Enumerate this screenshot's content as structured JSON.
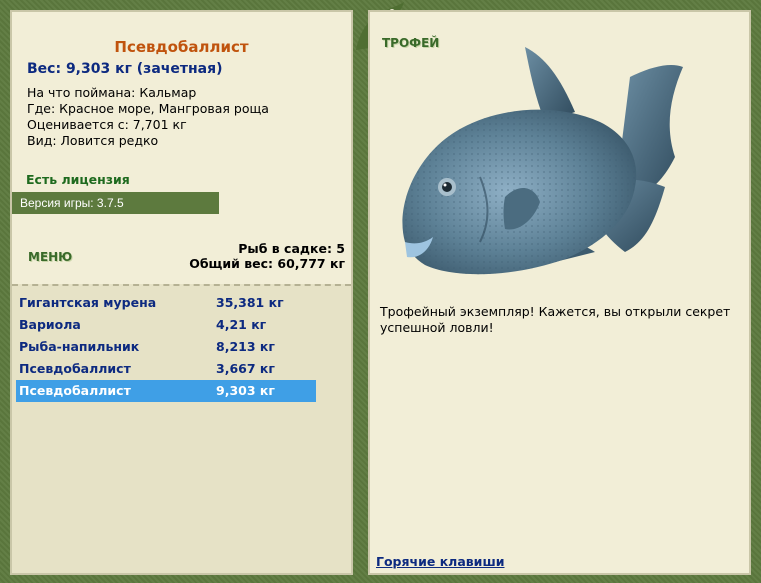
{
  "fish": {
    "name": "Псевдобаллист",
    "weight_line": "Вес: 9,303 кг (зачетная)",
    "bait": "На что поймана: Кальмар",
    "location": "Где: Красное море, Мангровая роща",
    "value": "Оценивается с: 7,701 кг",
    "kind": "Вид: Ловится редко"
  },
  "license": "Есть лицензия",
  "version": "Версия игры: 3.7.5",
  "menu_label": "МЕНЮ",
  "stats": {
    "fish_in_net": "Рыб в садке: 5",
    "total_weight": "Общий вес: 60,777 кг"
  },
  "catches": [
    {
      "name": "Гигантская мурена",
      "weight": "35,381 кг",
      "selected": false
    },
    {
      "name": "Вариола",
      "weight": "4,21 кг",
      "selected": false
    },
    {
      "name": "Рыба-напильник",
      "weight": "8,213 кг",
      "selected": false
    },
    {
      "name": "Псевдобаллист",
      "weight": "3,667 кг",
      "selected": false
    },
    {
      "name": "Псевдобаллист",
      "weight": "9,303 кг",
      "selected": true
    }
  ],
  "trophy": {
    "label": "ТРОФЕЙ",
    "text": "Трофейный экземпляр! Кажется, вы открыли секрет успешной ловли!"
  },
  "hotkeys": "Горячие клавиши",
  "colors": {
    "background": "#5d7a3e",
    "panel": "#f2eed7",
    "title": "#c0530d",
    "link": "#0d2a80",
    "selection": "#3f9fe6",
    "license": "#1e6a1e"
  },
  "icons": {
    "corner": "frog-icon",
    "fish": "triggerfish-image"
  }
}
